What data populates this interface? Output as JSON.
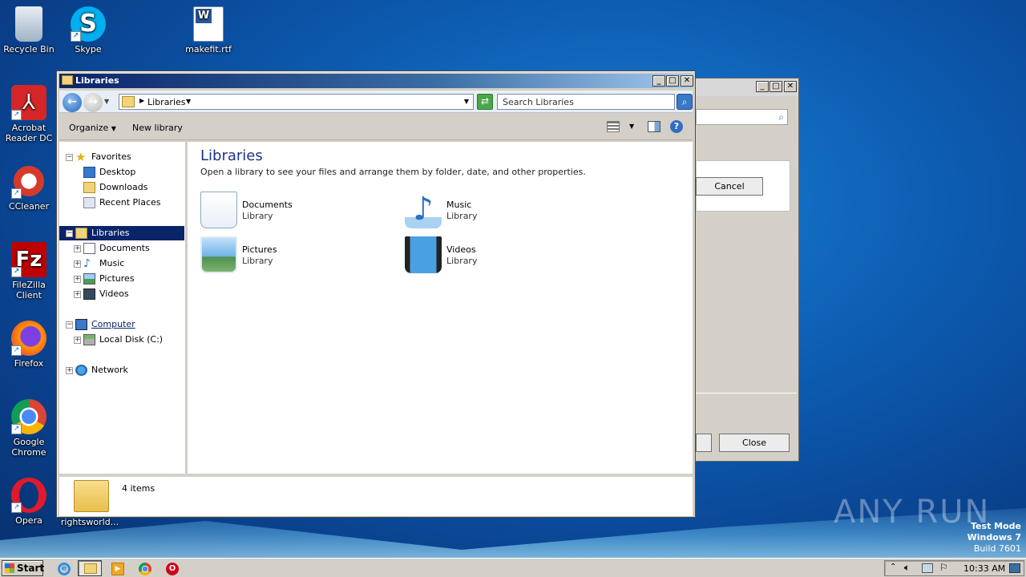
{
  "desktop": {
    "icons": [
      {
        "label": "Recycle Bin"
      },
      {
        "label": "Skype"
      },
      {
        "label": "makefit.rtf"
      },
      {
        "label": "Acrobat Reader DC"
      },
      {
        "label": "CCleaner"
      },
      {
        "label": "FileZilla Client"
      },
      {
        "label": "Firefox"
      },
      {
        "label": "Google Chrome"
      },
      {
        "label": "Opera"
      },
      {
        "label": "rightsworld..."
      }
    ]
  },
  "back_window": {
    "cancel_label": "Cancel",
    "close_label": "Close"
  },
  "explorer": {
    "title": "Libraries",
    "address": "Libraries",
    "search_placeholder": "Search Libraries",
    "toolbar": {
      "organize": "Organize",
      "new_library": "New library"
    },
    "nav": {
      "favorites": "Favorites",
      "desktop": "Desktop",
      "downloads": "Downloads",
      "recent_places": "Recent Places",
      "libraries": "Libraries",
      "documents": "Documents",
      "music": "Music",
      "pictures": "Pictures",
      "videos": "Videos",
      "computer": "Computer",
      "local_disk": "Local Disk (C:)",
      "network": "Network"
    },
    "content": {
      "heading": "Libraries",
      "description": "Open a library to see your files and arrange them by folder, date, and other properties.",
      "libraries": [
        {
          "name": "Documents",
          "sub": "Library"
        },
        {
          "name": "Music",
          "sub": "Library"
        },
        {
          "name": "Pictures",
          "sub": "Library"
        },
        {
          "name": "Videos",
          "sub": "Library"
        }
      ]
    },
    "status": "4 items"
  },
  "taskbar": {
    "start_label": "Start",
    "clock": "10:33 AM"
  },
  "watermark": {
    "brand": "ANY RUN",
    "line1": "Test Mode",
    "line2": "Windows 7",
    "line3": "Build 7601"
  }
}
